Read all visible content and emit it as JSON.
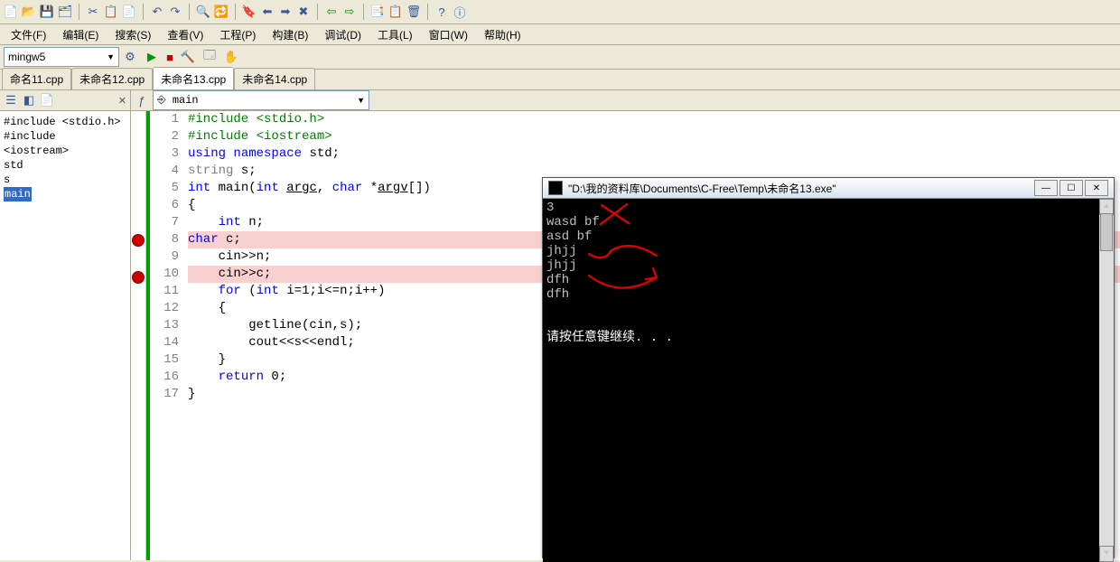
{
  "menus": {
    "file": "文件(F)",
    "edit": "编辑(E)",
    "search": "搜索(S)",
    "view": "查看(V)",
    "project": "工程(P)",
    "build": "构建(B)",
    "debug": "调试(D)",
    "tools": "工具(L)",
    "window": "窗口(W)",
    "help": "帮助(H)"
  },
  "buildbar": {
    "config": "mingw5"
  },
  "tabs": [
    "命名11.cpp",
    "未命名12.cpp",
    "未命名13.cpp",
    "未命名14.cpp"
  ],
  "active_tab": 2,
  "symbol_list": [
    "#include <stdio.h>",
    "#include <iostream>",
    "std",
    "s",
    "main"
  ],
  "symbol_selected": 4,
  "editor": {
    "scope": "main"
  },
  "code": {
    "lines": [
      {
        "n": 1,
        "seg": [
          {
            "c": "kw-pp",
            "t": "#include <stdio.h>"
          }
        ]
      },
      {
        "n": 2,
        "seg": [
          {
            "c": "kw-pp",
            "t": "#include <iostream>"
          }
        ]
      },
      {
        "n": 3,
        "seg": [
          {
            "c": "kw-blue",
            "t": "using"
          },
          {
            "c": "",
            "t": " "
          },
          {
            "c": "kw-blue",
            "t": "namespace"
          },
          {
            "c": "",
            "t": " std;"
          }
        ]
      },
      {
        "n": 4,
        "seg": [
          {
            "c": "kw-gray",
            "t": "string"
          },
          {
            "c": "",
            "t": " s;"
          }
        ]
      },
      {
        "n": 5,
        "seg": [
          {
            "c": "kw-blue",
            "t": "int"
          },
          {
            "c": "",
            "t": " main("
          },
          {
            "c": "kw-blue",
            "t": "int"
          },
          {
            "c": "",
            "t": " "
          },
          {
            "c": "uline",
            "t": "argc"
          },
          {
            "c": "",
            "t": ", "
          },
          {
            "c": "kw-blue",
            "t": "char"
          },
          {
            "c": "",
            "t": " *"
          },
          {
            "c": "uline",
            "t": "argv"
          },
          {
            "c": "",
            "t": "[])"
          }
        ]
      },
      {
        "n": 6,
        "seg": [
          {
            "c": "",
            "t": "{"
          }
        ]
      },
      {
        "n": 7,
        "seg": [
          {
            "c": "",
            "t": "    "
          },
          {
            "c": "kw-blue",
            "t": "int"
          },
          {
            "c": "",
            "t": " n;"
          }
        ]
      },
      {
        "n": 8,
        "hl": true,
        "bp": true,
        "seg": [
          {
            "c": "kw-blue",
            "t": "char"
          },
          {
            "c": "",
            "t": " c;"
          }
        ]
      },
      {
        "n": 9,
        "seg": [
          {
            "c": "",
            "t": "    cin>>n;"
          }
        ]
      },
      {
        "n": 10,
        "hl": true,
        "bp": true,
        "seg": [
          {
            "c": "",
            "t": "    cin>>c;"
          }
        ]
      },
      {
        "n": 11,
        "seg": [
          {
            "c": "",
            "t": "    "
          },
          {
            "c": "kw-blue",
            "t": "for"
          },
          {
            "c": "",
            "t": " ("
          },
          {
            "c": "kw-blue",
            "t": "int"
          },
          {
            "c": "",
            "t": " i=1;i<=n;i++)"
          }
        ]
      },
      {
        "n": 12,
        "seg": [
          {
            "c": "",
            "t": "    {"
          }
        ]
      },
      {
        "n": 13,
        "seg": [
          {
            "c": "",
            "t": "        getline(cin,s);"
          }
        ]
      },
      {
        "n": 14,
        "seg": [
          {
            "c": "",
            "t": "        cout<<s<<endl;"
          }
        ]
      },
      {
        "n": 15,
        "seg": [
          {
            "c": "",
            "t": "    }"
          }
        ]
      },
      {
        "n": 16,
        "seg": [
          {
            "c": "",
            "t": "    "
          },
          {
            "c": "kw-blue",
            "t": "return"
          },
          {
            "c": "",
            "t": " 0;"
          }
        ]
      },
      {
        "n": 17,
        "seg": [
          {
            "c": "",
            "t": "}"
          }
        ]
      }
    ]
  },
  "console": {
    "title": "\"D:\\我的资料库\\Documents\\C-Free\\Temp\\未命名13.exe\"",
    "lines": [
      "3",
      "wasd bf",
      "asd bf",
      "jhjj",
      "jhjj",
      "dfh",
      "dfh"
    ],
    "prompt": "请按任意键继续. . ."
  }
}
